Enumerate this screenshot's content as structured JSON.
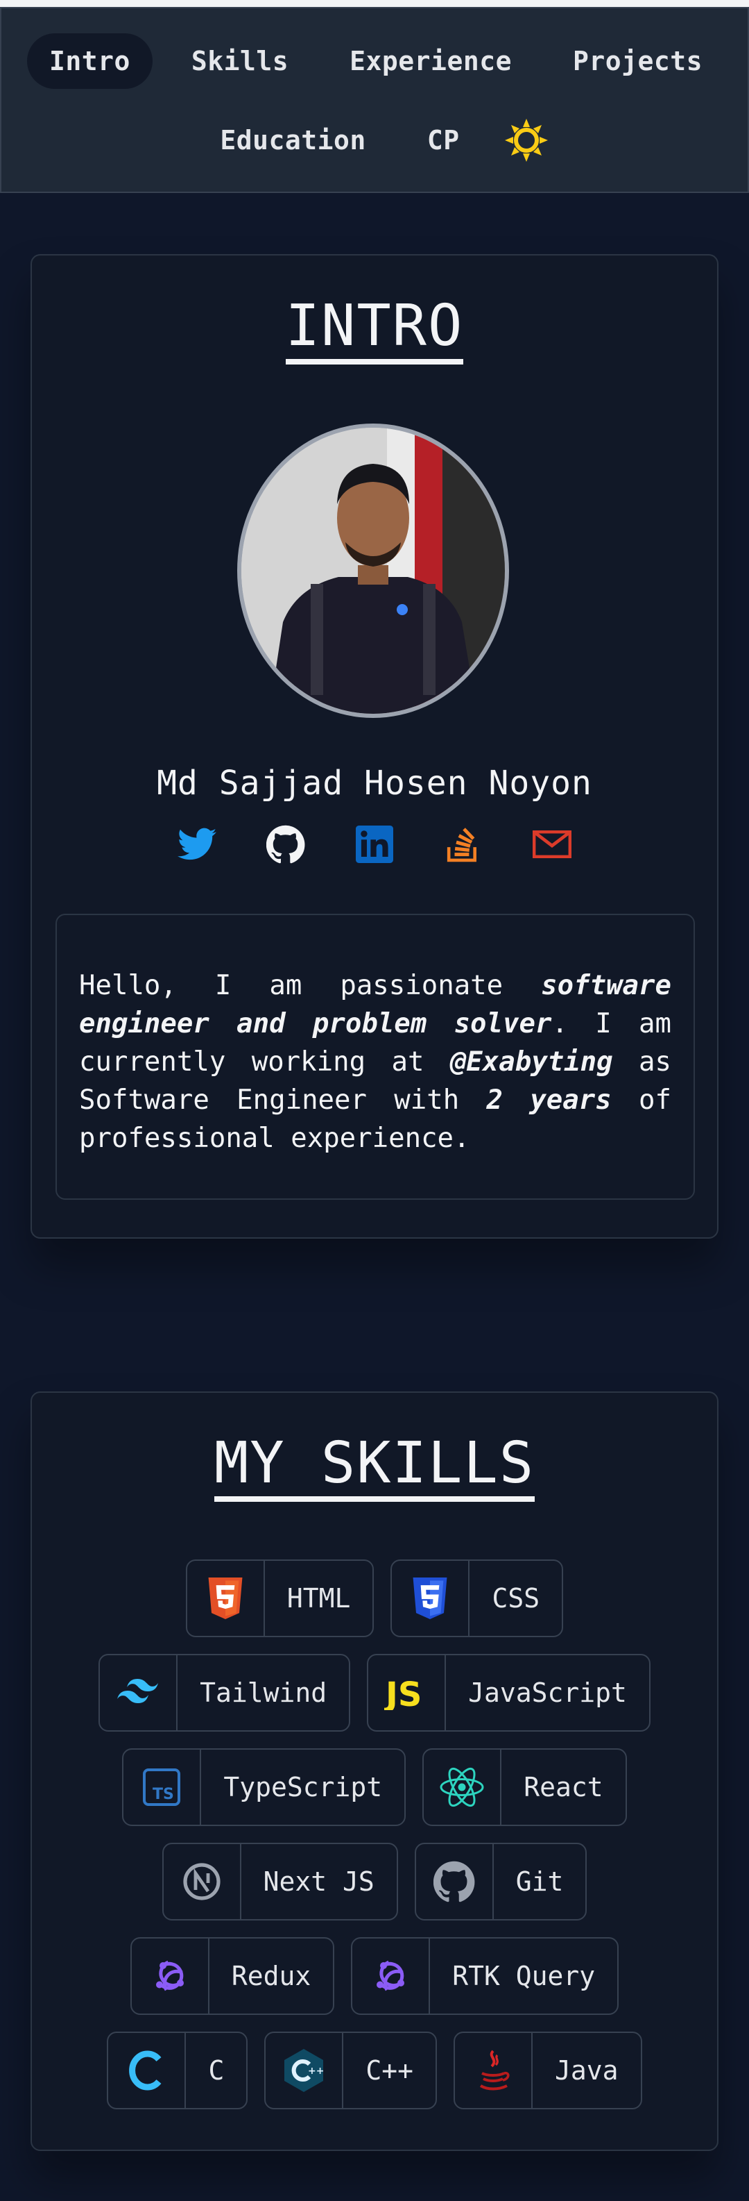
{
  "nav": {
    "items": [
      "Intro",
      "Skills",
      "Experience",
      "Projects",
      "Education",
      "CP"
    ],
    "active": "Intro",
    "theme_icon": "sun-icon"
  },
  "intro": {
    "title": "INTRO",
    "name": "Md Sajjad Hosen Noyon",
    "socials": [
      {
        "icon": "twitter-icon",
        "color": "#1d9bf0"
      },
      {
        "icon": "github-icon",
        "color": "#f3f4f6"
      },
      {
        "icon": "linkedin-icon",
        "color": "#0a66c2"
      },
      {
        "icon": "stackoverflow-icon",
        "color": "#f48024"
      },
      {
        "icon": "mail-icon",
        "color": "#dc3b2a"
      }
    ],
    "bio": {
      "p1": "Hello, I am passionate ",
      "b1": "software engineer and problem solver",
      "p2": ". I am currently working at ",
      "b2": "@Exabyting",
      "p3": " as Software Engineer with ",
      "b3": "2 years",
      "p4": " of professional experience."
    }
  },
  "skills": {
    "title": "MY SKILLS",
    "rows": [
      [
        {
          "label": "HTML",
          "icon": "html5-icon"
        },
        {
          "label": "CSS",
          "icon": "css3-icon"
        }
      ],
      [
        {
          "label": "Tailwind",
          "icon": "tailwind-icon"
        },
        {
          "label": "JavaScript",
          "icon": "javascript-icon"
        }
      ],
      [
        {
          "label": "TypeScript",
          "icon": "typescript-icon"
        },
        {
          "label": "React",
          "icon": "react-icon"
        }
      ],
      [
        {
          "label": "Next JS",
          "icon": "nextjs-icon"
        },
        {
          "label": "Git",
          "icon": "github-icon"
        }
      ],
      [
        {
          "label": "Redux",
          "icon": "redux-icon"
        },
        {
          "label": "RTK Query",
          "icon": "redux-icon"
        }
      ],
      [
        {
          "label": "C",
          "icon": "c-icon"
        },
        {
          "label": "C++",
          "icon": "cpp-icon"
        },
        {
          "label": "Java",
          "icon": "java-icon"
        }
      ]
    ]
  },
  "colors": {
    "background": "#0f172a",
    "nav_bg": "#1f2937",
    "card_border": "#2b3544",
    "sun": "#facc15"
  }
}
